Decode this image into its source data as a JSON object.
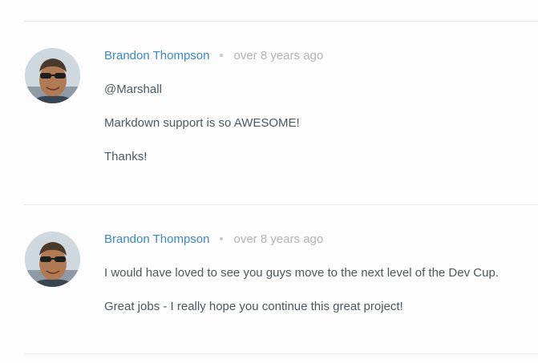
{
  "comments": [
    {
      "author": "Brandon Thompson",
      "separator_icon": "bullet-dot",
      "time": "over 8 years ago",
      "avatar_icon": "user-avatar",
      "paragraphs": [
        "@Marshall",
        "Markdown support is so AWESOME!",
        "Thanks!"
      ]
    },
    {
      "author": "Brandon Thompson",
      "separator_icon": "bullet-dot",
      "time": "over 8 years ago",
      "avatar_icon": "user-avatar",
      "paragraphs": [
        "I would have loved to see you guys move to the next level of the Dev Cup.",
        "Great jobs - I really hope you continue this great project!"
      ]
    }
  ],
  "colors": {
    "author_link": "#3889c4",
    "timestamp": "#b3b3b3",
    "body_text": "#4d5760",
    "divider": "#ececec"
  }
}
